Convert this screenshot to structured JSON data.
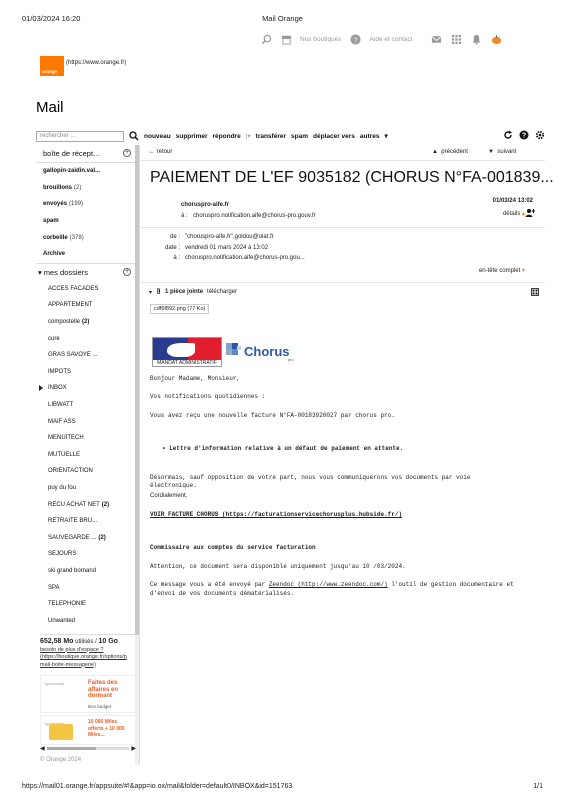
{
  "print": {
    "datetime": "01/03/2024 16:20",
    "title": "Mail Orange",
    "url": "https://mail01.orange.fr/appsuite/#!&app=io.ox/mail&folder=default0/INBOX&id=151763",
    "page": "1/1"
  },
  "topnav": {
    "boutiques_label": "Nos boutiques",
    "aide_label": "Aide et contact"
  },
  "logo": {
    "text": "orange",
    "link": "(https://www.orange.fr)",
    "color": "#ff7900"
  },
  "heading": "Mail",
  "toolbar": {
    "search_placeholder": "rechercher ...",
    "nouveau": "nouveau",
    "supprimer": "supprimer",
    "repondre": "répondre",
    "transferer": "transférer",
    "spam": "spam",
    "deplacer": "déplacer vers",
    "autres": "autres"
  },
  "sidebar": {
    "inbox": "boîte de récept...",
    "folders": [
      {
        "label": "gallopin-zaidin.val...",
        "count": ""
      },
      {
        "label": "brouillons",
        "count": "(2)"
      },
      {
        "label": "envoyés",
        "count": "(199)"
      },
      {
        "label": "spam",
        "count": ""
      },
      {
        "label": "corbeille",
        "count": "(378)"
      },
      {
        "label": "Archive",
        "count": ""
      }
    ],
    "mes_dossiers": "mes dossiers",
    "subfolders": [
      {
        "label": "ACCES FACADES",
        "count": ""
      },
      {
        "label": "APPARTEMENT",
        "count": ""
      },
      {
        "label": "compostelle",
        "count": "(2)"
      },
      {
        "label": "cure",
        "count": ""
      },
      {
        "label": "GRAS SAVOYE ...",
        "count": ""
      },
      {
        "label": "IMPOTS",
        "count": ""
      },
      {
        "label": "INBOX",
        "count": ""
      },
      {
        "label": "LIBWATT",
        "count": ""
      },
      {
        "label": "MAIF ASS",
        "count": ""
      },
      {
        "label": "MENUITECH",
        "count": ""
      },
      {
        "label": "MUTUELLE",
        "count": ""
      },
      {
        "label": "ORIENTACTION",
        "count": ""
      },
      {
        "label": "puy du fou",
        "count": ""
      },
      {
        "label": "RECU ACHAT NET",
        "count": "(2)"
      },
      {
        "label": "RETRAITE BRU...",
        "count": ""
      },
      {
        "label": "SAUVEGARDE ...",
        "count": "(2)"
      },
      {
        "label": "SEJOURS",
        "count": ""
      },
      {
        "label": "ski grand bornand",
        "count": ""
      },
      {
        "label": "SPA",
        "count": ""
      },
      {
        "label": "TELEPHONIE",
        "count": ""
      },
      {
        "label": "Unwanted",
        "count": ""
      }
    ],
    "quota_used": "652,58 Mo",
    "quota_text": " utilisés / ",
    "quota_total": "10 Go",
    "quota_link1": "besoin de plus d'espace ?",
    "quota_link2": "(https://boutique.orange.fr/options/p",
    "quota_link3": "mail-boite-messagerie)",
    "ad1_sponsor": "sponsorisé",
    "ad1_text": "Faites des affaires en dormant",
    "ad1_sub": "Bon budget",
    "ad2_sponsor": "sponsorisé",
    "ad2_text": "10 000 Miles offerts + 10 000 Miles...",
    "copyright": "© Orange 2024"
  },
  "email": {
    "retour": "retour",
    "precedent": "précédent",
    "suivant": "suivant",
    "subject": "PAIEMENT DE L'EF 9035182 (CHORUS N°FA-001839...",
    "sender": "choruspro-aife.fr",
    "to_label": "à :",
    "to": "choruspro.notification.aife@chorus-pro.gouv.fr",
    "date_short": "01/03/24 13:02",
    "details": "détails",
    "de_label": "de :",
    "de": "\"choruspro-aife.fr\",goldou@olat.fr",
    "date_label": "date :",
    "date": "vendredi 01 mars 2024 à 13:02",
    "a_label": "à :",
    "a": "choruspro.notification.aife@chorus-pro.gou...",
    "entete": "en-tête complet",
    "attach_count": "1 pièce jointe",
    "telecharger": "télécharger",
    "file": "cdf6f892.png (77 Ko)",
    "mandat_label": "MANDAT ADMINISTRATIF",
    "chorus_word": "Chorus",
    "chorus_pro": "pro",
    "l1": "Bonjour Madame, Monsieur,",
    "l2": "Vos notifications quotidiennes :",
    "l3": "Vous avez reçu une nouvelle facture N°FA-00183920027 par chorus pro.",
    "l4": "• Lettre d'information relative à un défaut de paiement en attente.",
    "l5": "Désormais, sauf opposition de votre part, nous vous communiquerons vos documents par voie électronique.",
    "l6": "Cordialement,",
    "l7": "VOIR FACTURE CHORUS (https://facturationservicechorusplus.hubside.fr/)",
    "l8": "Commissaire aux comptes du service facturation",
    "l9": "Attention, ce document sera disponible uniquement jusqu'au 10 /03/2024.",
    "l10a": "Ce message vous a été envoyé par ",
    "l10b": "Zeendoc (http://www.zeendoc.com/)",
    "l10c": " l'outil de gestion documentaire et",
    "l11": "d'envoi de vos documents dématérialisés."
  }
}
